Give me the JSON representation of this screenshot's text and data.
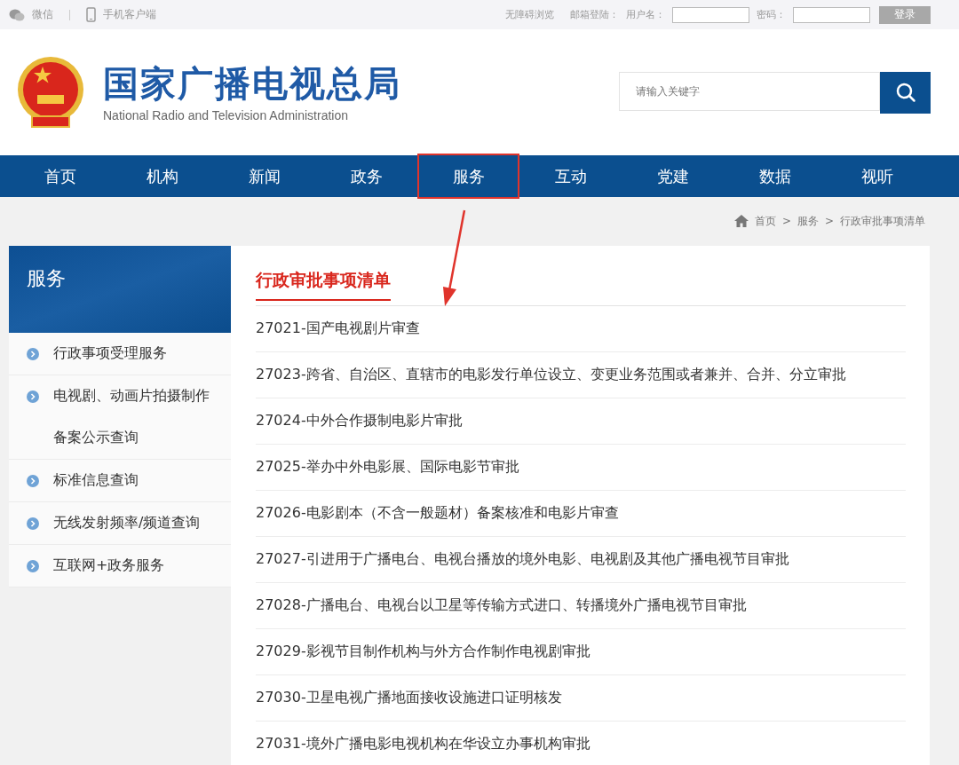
{
  "top_bar": {
    "wechat": "微信",
    "mobile": "手机客户端",
    "accessible": "无障碍浏览",
    "mail_login": "邮箱登陆：",
    "username_label": "用户名：",
    "password_label": "密码：",
    "login_button": "登录"
  },
  "header": {
    "title": "国家广播电视总局",
    "subtitle": "National Radio and Television Administration",
    "search": {
      "placeholder": "请输入关键字"
    }
  },
  "nav": [
    {
      "label": "首页",
      "highlighted": false
    },
    {
      "label": "机构",
      "highlighted": false
    },
    {
      "label": "新闻",
      "highlighted": false
    },
    {
      "label": "政务",
      "highlighted": false
    },
    {
      "label": "服务",
      "highlighted": true
    },
    {
      "label": "互动",
      "highlighted": false
    },
    {
      "label": "党建",
      "highlighted": false
    },
    {
      "label": "数据",
      "highlighted": false
    },
    {
      "label": "视听",
      "highlighted": false
    }
  ],
  "breadcrumb": [
    "首页",
    "服务",
    "行政审批事项清单"
  ],
  "breadcrumb_separators": [
    ">",
    ">"
  ],
  "sidebar": {
    "title": "服务",
    "items": [
      {
        "label": "行政事项受理服务"
      },
      {
        "label": "电视剧、动画片拍摄制作",
        "continuation": "备案公示查询"
      },
      {
        "label": "标准信息查询"
      },
      {
        "label": "无线发射频率/频道查询"
      },
      {
        "label": "互联网+政务服务"
      }
    ]
  },
  "content": {
    "heading": "行政审批事项清单",
    "items": [
      "27021-国产电视剧片审查",
      "27023-跨省、自治区、直辖市的电影发行单位设立、变更业务范围或者兼并、合并、分立审批",
      "27024-中外合作摄制电影片审批",
      "27025-举办中外电影展、国际电影节审批",
      "27026-电影剧本（不含一般题材）备案核准和电影片审查",
      "27027-引进用于广播电台、电视台播放的境外电影、电视剧及其他广播电视节目审批",
      "27028-广播电台、电视台以卫星等传输方式进口、转播境外广播电视节目审批",
      "27029-影视节目制作机构与外方合作制作电视剧审批",
      "27030-卫星电视广播地面接收设施进口证明核发",
      "27031-境外广播电影电视机构在华设立办事机构审批"
    ]
  }
}
